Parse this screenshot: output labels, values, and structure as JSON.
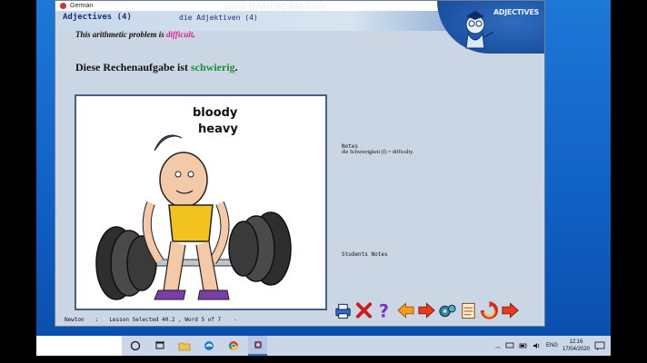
{
  "window": {
    "title": "German",
    "controls": [
      "—",
      "☐",
      "✕"
    ]
  },
  "watermark": "www.BANDICAM.com",
  "lesson": {
    "title": "Adjectives (4)",
    "subtitle": "die Adjektiven (4)",
    "badge": "ADJECTIVES"
  },
  "content": {
    "english_prefix": "This arithmetic problem is ",
    "english_highlight": "difficult",
    "english_suffix": ".",
    "german_prefix": "Diese Rechenaufgabe ist ",
    "german_highlight": "schwierig",
    "german_suffix": ".",
    "picture_caption_1": "bloody",
    "picture_caption_2": "heavy"
  },
  "notes": {
    "label": "Notes",
    "text": "die Schwierigkeit (f) = difficulty.",
    "students_label": "Students Notes"
  },
  "status": {
    "name": "Newton",
    "sep": ":",
    "lesson": "Lesson Selected 40.2 , Word 5 of 7",
    "dash": "-"
  },
  "toolbar": {
    "buttons": [
      "print-icon",
      "close-icon",
      "help-icon",
      "back-icon",
      "forward-icon",
      "settings-icon",
      "notes-icon",
      "refresh-icon",
      "next-icon"
    ]
  },
  "taskbar": {
    "language": "ENG",
    "time": "12:16",
    "date": "17/04/2020"
  },
  "colors": {
    "highlight_english": "#e0208c",
    "highlight_german": "#1e8a3a",
    "window_bg": "#cbd6e4"
  }
}
